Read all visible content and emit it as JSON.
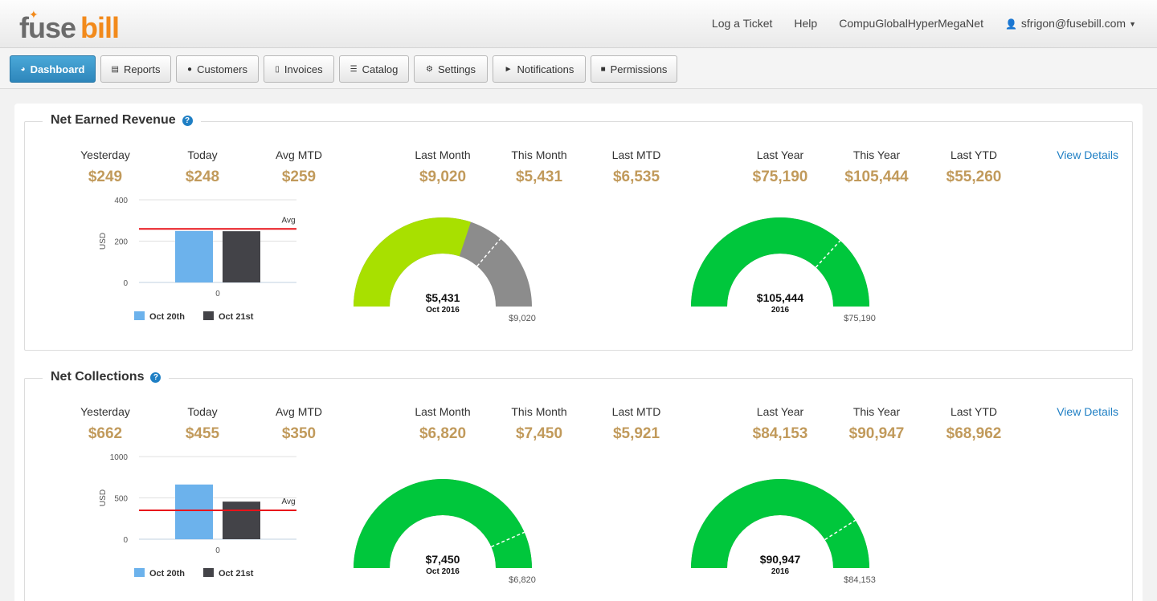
{
  "brand": {
    "fuse": "fuse",
    "bill": "bill",
    "accent": "#f28a1b"
  },
  "topnav": {
    "log_ticket": "Log a Ticket",
    "help": "Help",
    "company": "CompuGlobalHyperMegaNet",
    "user": "sfrigon@fusebill.com"
  },
  "nav": [
    {
      "label": "Dashboard",
      "icon": "dashboard-icon",
      "active": true
    },
    {
      "label": "Reports",
      "icon": "bar-chart-icon"
    },
    {
      "label": "Customers",
      "icon": "user-icon"
    },
    {
      "label": "Invoices",
      "icon": "document-icon"
    },
    {
      "label": "Catalog",
      "icon": "list-icon"
    },
    {
      "label": "Settings",
      "icon": "gears-icon"
    },
    {
      "label": "Notifications",
      "icon": "megaphone-icon"
    },
    {
      "label": "Permissions",
      "icon": "lock-icon"
    }
  ],
  "panels": [
    {
      "title": "Net Earned Revenue",
      "view_details": "View Details",
      "stats": [
        {
          "label": "Yesterday",
          "value": "$249"
        },
        {
          "label": "Today",
          "value": "$248"
        },
        {
          "label": "Avg MTD",
          "value": "$259"
        },
        {
          "label": "Last Month",
          "value": "$9,020"
        },
        {
          "label": "This Month",
          "value": "$5,431"
        },
        {
          "label": "Last MTD",
          "value": "$6,535"
        },
        {
          "label": "Last Year",
          "value": "$75,190"
        },
        {
          "label": "This Year",
          "value": "$105,444"
        },
        {
          "label": "Last YTD",
          "value": "$55,260"
        }
      ],
      "chart_data": {
        "type": "bar",
        "ylabel": "USD",
        "ylim": [
          0,
          400
        ],
        "yticks": [
          "0",
          "200",
          "400"
        ],
        "categories": [
          "0"
        ],
        "series": [
          {
            "name": "Oct 20th",
            "values": [
              249
            ],
            "color": "#6cb2ec"
          },
          {
            "name": "Oct 21st",
            "values": [
              248
            ],
            "color": "#434348"
          }
        ],
        "avg": 259,
        "avg_label": "Avg",
        "legend": "bottom"
      },
      "gauges": [
        {
          "center_value": "$5,431",
          "center_sub": "Oct 2016",
          "max_label": "$9,020",
          "value": 5431,
          "max": 9020,
          "marker": 6535,
          "fill": "#a8e000",
          "track": "#8c8c8c"
        },
        {
          "center_value": "$105,444",
          "center_sub": "2016",
          "max_label": "$75,190",
          "value": 105444,
          "max": 75190,
          "marker": 55260,
          "fill": "#00c73c",
          "track": "#8c8c8c"
        }
      ]
    },
    {
      "title": "Net Collections",
      "view_details": "View Details",
      "stats": [
        {
          "label": "Yesterday",
          "value": "$662"
        },
        {
          "label": "Today",
          "value": "$455"
        },
        {
          "label": "Avg MTD",
          "value": "$350"
        },
        {
          "label": "Last Month",
          "value": "$6,820"
        },
        {
          "label": "This Month",
          "value": "$7,450"
        },
        {
          "label": "Last MTD",
          "value": "$5,921"
        },
        {
          "label": "Last Year",
          "value": "$84,153"
        },
        {
          "label": "This Year",
          "value": "$90,947"
        },
        {
          "label": "Last YTD",
          "value": "$68,962"
        }
      ],
      "chart_data": {
        "type": "bar",
        "ylabel": "USD",
        "ylim": [
          0,
          1000
        ],
        "yticks": [
          "0",
          "500",
          "1000"
        ],
        "categories": [
          "0"
        ],
        "series": [
          {
            "name": "Oct 20th",
            "values": [
              662
            ],
            "color": "#6cb2ec"
          },
          {
            "name": "Oct 21st",
            "values": [
              455
            ],
            "color": "#434348"
          }
        ],
        "avg": 350,
        "avg_label": "Avg",
        "legend": "bottom"
      },
      "gauges": [
        {
          "center_value": "$7,450",
          "center_sub": "Oct 2016",
          "max_label": "$6,820",
          "value": 7450,
          "max": 6820,
          "marker": 5921,
          "fill": "#00c73c",
          "track": "#8c8c8c"
        },
        {
          "center_value": "$90,947",
          "center_sub": "2016",
          "max_label": "$84,153",
          "value": 90947,
          "max": 84153,
          "marker": 68962,
          "fill": "#00c73c",
          "track": "#8c8c8c"
        }
      ]
    }
  ]
}
